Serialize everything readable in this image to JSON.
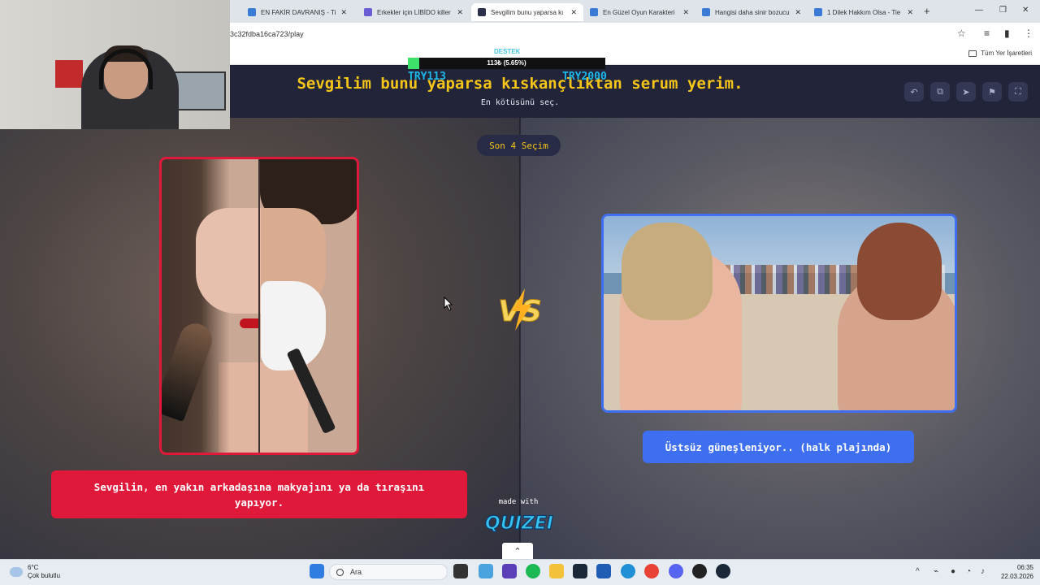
{
  "browser": {
    "tabs": [
      {
        "title": "EN FAKİR DAVRANIŞ - Tie",
        "active": false
      },
      {
        "title": "Erkekler için LİBİDO killer",
        "active": false
      },
      {
        "title": "Sevgilim bunu yaparsa kı",
        "active": true
      },
      {
        "title": "En Güzel Oyun Karakteri",
        "active": false
      },
      {
        "title": "Hangisi daha sinir bozucu",
        "active": false
      },
      {
        "title": "1 Dilek Hakkım Olsa - Tie",
        "active": false
      }
    ],
    "new_tab": "+",
    "url": "3c32fdba16ca723/play",
    "bookmarks_all": "Tüm Yer İşaretleri"
  },
  "donation": {
    "label": "DESTEK",
    "amount": "113₺ (5.65%)",
    "progress_pct": 5.65,
    "min": "TRY113",
    "max": "TRY2000",
    "fill_color": "#3ce06a"
  },
  "quiz": {
    "title": "Sevgilim bunu yaparsa kıskançlıktan serum yerim.",
    "subtitle": "En kötüsünü seç.",
    "round": "Son 4 Seçim",
    "vs": "VS",
    "options": [
      {
        "text": "Sevgilin, en yakın arkadaşına makyajını ya da tıraşını yapıyor.",
        "color": "#e0193a"
      },
      {
        "text": "Üstsüz güneşleniyor.. (halk plajında)",
        "color": "#3d6ff0"
      }
    ],
    "made_with": "made with",
    "brand": "QUIZEI",
    "accent": "#f5c518"
  },
  "header_buttons": [
    "undo-icon",
    "share-icon",
    "send-icon",
    "flag-icon",
    "fullscreen-icon"
  ],
  "taskbar": {
    "temp": "6°C",
    "condition": "Çok bulutlu",
    "search_placeholder": "Ara",
    "time": "06:35",
    "date": "22.03.2026"
  }
}
